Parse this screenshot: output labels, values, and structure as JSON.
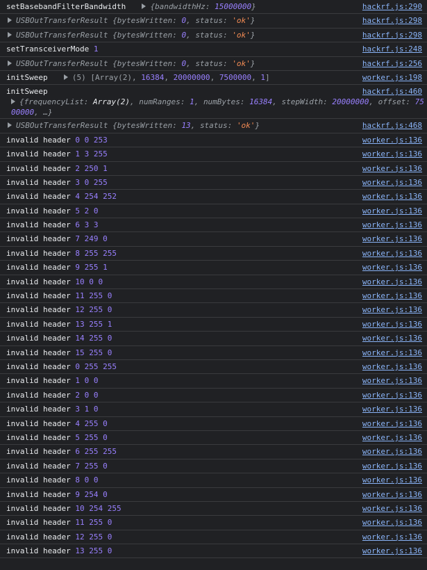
{
  "rows": [
    {
      "label": "setBasebandFilterBandwidth",
      "obj_key": "bandwidthHz",
      "obj_val": "15000000",
      "source": "hackrf.js:290"
    },
    {
      "obj_name": "USBOutTransferResult",
      "k1": "bytesWritten",
      "v1": "0",
      "k2": "status",
      "v2": "'ok'",
      "source": "hackrf.js:298"
    },
    {
      "obj_name": "USBOutTransferResult",
      "k1": "bytesWritten",
      "v1": "0",
      "k2": "status",
      "v2": "'ok'",
      "source": "hackrf.js:298"
    },
    {
      "label": "setTransceiverMode",
      "value": "1",
      "source": "hackrf.js:248"
    },
    {
      "obj_name": "USBOutTransferResult",
      "k1": "bytesWritten",
      "v1": "0",
      "k2": "status",
      "v2": "'ok'",
      "source": "hackrf.js:256"
    },
    {
      "label": "initSweep",
      "arr_prefix": "(5) [Array(2), ",
      "a1": "16384",
      "a2": "20000000",
      "a3": "7500000",
      "a4": "1",
      "source": "worker.js:198"
    },
    {
      "label": "initSweep",
      "source": "hackrf.js:460",
      "frequencyList_key": "frequencyList",
      "frequencyList_val": "Array(2)",
      "numRanges_key": "numRanges",
      "numRanges_val": "1",
      "numBytes_key": "numBytes",
      "numBytes_val": "16384",
      "stepWidth_key": "stepWidth",
      "stepWidth_val": "20000000",
      "offset_key": "offset",
      "offset_val": "7500000"
    },
    {
      "obj_name": "USBOutTransferResult",
      "k1": "bytesWritten",
      "v1": "13",
      "k2": "status",
      "v2": "'ok'",
      "source": "hackrf.js:468"
    }
  ],
  "header_rows": [
    {
      "text": "invalid header",
      "a": "0",
      "b": "0",
      "c": "253",
      "source": "worker.js:136"
    },
    {
      "text": "invalid header",
      "a": "1",
      "b": "3",
      "c": "255",
      "source": "worker.js:136"
    },
    {
      "text": "invalid header",
      "a": "2",
      "b": "250",
      "c": "1",
      "source": "worker.js:136"
    },
    {
      "text": "invalid header",
      "a": "3",
      "b": "0",
      "c": "255",
      "source": "worker.js:136"
    },
    {
      "text": "invalid header",
      "a": "4",
      "b": "254",
      "c": "252",
      "source": "worker.js:136"
    },
    {
      "text": "invalid header",
      "a": "5",
      "b": "2",
      "c": "0",
      "source": "worker.js:136"
    },
    {
      "text": "invalid header",
      "a": "6",
      "b": "3",
      "c": "3",
      "source": "worker.js:136"
    },
    {
      "text": "invalid header",
      "a": "7",
      "b": "249",
      "c": "0",
      "source": "worker.js:136"
    },
    {
      "text": "invalid header",
      "a": "8",
      "b": "255",
      "c": "255",
      "source": "worker.js:136"
    },
    {
      "text": "invalid header",
      "a": "9",
      "b": "255",
      "c": "1",
      "source": "worker.js:136"
    },
    {
      "text": "invalid header",
      "a": "10",
      "b": "0",
      "c": "0",
      "source": "worker.js:136"
    },
    {
      "text": "invalid header",
      "a": "11",
      "b": "255",
      "c": "0",
      "source": "worker.js:136"
    },
    {
      "text": "invalid header",
      "a": "12",
      "b": "255",
      "c": "0",
      "source": "worker.js:136"
    },
    {
      "text": "invalid header",
      "a": "13",
      "b": "255",
      "c": "1",
      "source": "worker.js:136"
    },
    {
      "text": "invalid header",
      "a": "14",
      "b": "255",
      "c": "0",
      "source": "worker.js:136"
    },
    {
      "text": "invalid header",
      "a": "15",
      "b": "255",
      "c": "0",
      "source": "worker.js:136"
    },
    {
      "text": "invalid header",
      "a": "0",
      "b": "255",
      "c": "255",
      "source": "worker.js:136"
    },
    {
      "text": "invalid header",
      "a": "1",
      "b": "0",
      "c": "0",
      "source": "worker.js:136"
    },
    {
      "text": "invalid header",
      "a": "2",
      "b": "0",
      "c": "0",
      "source": "worker.js:136"
    },
    {
      "text": "invalid header",
      "a": "3",
      "b": "1",
      "c": "0",
      "source": "worker.js:136"
    },
    {
      "text": "invalid header",
      "a": "4",
      "b": "255",
      "c": "0",
      "source": "worker.js:136"
    },
    {
      "text": "invalid header",
      "a": "5",
      "b": "255",
      "c": "0",
      "source": "worker.js:136"
    },
    {
      "text": "invalid header",
      "a": "6",
      "b": "255",
      "c": "255",
      "source": "worker.js:136"
    },
    {
      "text": "invalid header",
      "a": "7",
      "b": "255",
      "c": "0",
      "source": "worker.js:136"
    },
    {
      "text": "invalid header",
      "a": "8",
      "b": "0",
      "c": "0",
      "source": "worker.js:136"
    },
    {
      "text": "invalid header",
      "a": "9",
      "b": "254",
      "c": "0",
      "source": "worker.js:136"
    },
    {
      "text": "invalid header",
      "a": "10",
      "b": "254",
      "c": "255",
      "source": "worker.js:136"
    },
    {
      "text": "invalid header",
      "a": "11",
      "b": "255",
      "c": "0",
      "source": "worker.js:136"
    },
    {
      "text": "invalid header",
      "a": "12",
      "b": "255",
      "c": "0",
      "source": "worker.js:136"
    },
    {
      "text": "invalid header",
      "a": "13",
      "b": "255",
      "c": "0",
      "source": "worker.js:136"
    }
  ],
  "colors": {
    "background": "#202124",
    "text": "#e8eaed",
    "number": "#9980ff",
    "string": "#f28b54",
    "link": "#8ab4f8",
    "divider": "#3a3b3e"
  },
  "icons": {
    "expand": "expand-triangle-icon"
  }
}
